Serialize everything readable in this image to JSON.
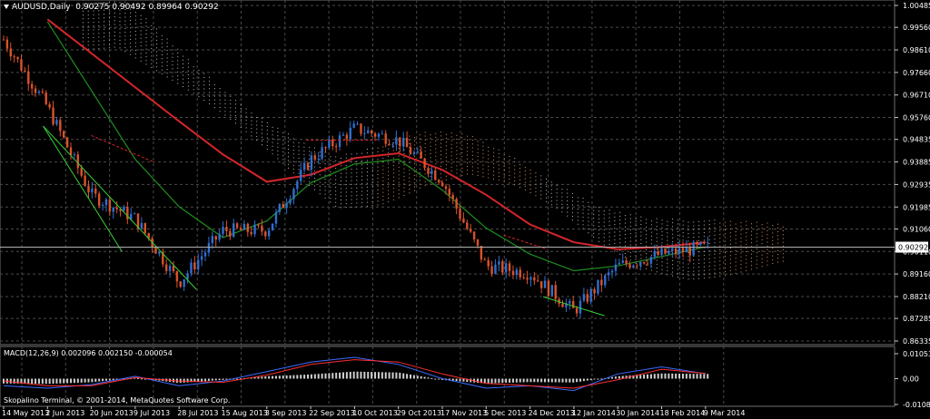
{
  "header": {
    "symbol": "AUDUSD,Daily",
    "ohlc": "0.90275 0.90492 0.89964 0.90292"
  },
  "macd_panel": {
    "label": "MACD(12,26,9) 0.002096 0.002150 -0.000054"
  },
  "footer": {
    "copyright": "Skopalino Terminal, © 2001-2014, MetaQuotes Software Corp."
  },
  "colors": {
    "background": "#000000",
    "grid": "#4a4a4a",
    "up_candle": "#2f6fd1",
    "down_candle": "#d9532b",
    "ma_slow": "#d4262a",
    "ma_fast": "#1f8f1f",
    "cloud_bear": "#c8b6b0",
    "cloud_bull": "#d99660",
    "current_price_line": "#b0b0b0",
    "trendline": "#37d137"
  },
  "chart_data": [
    {
      "type": "candlestick",
      "title": "AUDUSD,Daily",
      "x_ticks": [
        "14 May 2013",
        "2 Jun 2013",
        "20 Jun 2013",
        "9 Jul 2013",
        "28 Jul 2013",
        "15 Aug 2013",
        "3 Sep 2013",
        "22 Sep 2013",
        "10 Oct 2013",
        "29 Oct 2013",
        "17 Nov 2013",
        "5 Dec 2013",
        "24 Dec 2013",
        "12 Jan 2014",
        "30 Jan 2014",
        "18 Feb 2014",
        "9 Mar 2014"
      ],
      "y_ticks": [
        1.00485,
        0.9956,
        0.9861,
        0.9766,
        0.9671,
        0.9576,
        0.94835,
        0.93885,
        0.92935,
        0.91985,
        0.9106,
        0.9011,
        0.8916,
        0.8821,
        0.87285,
        0.86335
      ],
      "ylim": [
        0.86335,
        1.00485
      ],
      "current_price": 0.90292,
      "close_path": [
        {
          "x": "14 May 2013",
          "y": 0.9905
        },
        {
          "x": "2 Jun 2013",
          "y": 0.962
        },
        {
          "x": "20 Jun 2013",
          "y": 0.925
        },
        {
          "x": "9 Jul 2013",
          "y": 0.915
        },
        {
          "x": "28 Jul 2013",
          "y": 0.888
        },
        {
          "x": "15 Aug 2013",
          "y": 0.91
        },
        {
          "x": "3 Sep 2013",
          "y": 0.91
        },
        {
          "x": "22 Sep 2013",
          "y": 0.94
        },
        {
          "x": "10 Oct 2013",
          "y": 0.953
        },
        {
          "x": "29 Oct 2013",
          "y": 0.948
        },
        {
          "x": "17 Nov 2013",
          "y": 0.931
        },
        {
          "x": "5 Dec 2013",
          "y": 0.895
        },
        {
          "x": "24 Dec 2013",
          "y": 0.892
        },
        {
          "x": "12 Jan 2014",
          "y": 0.876
        },
        {
          "x": "30 Jan 2014",
          "y": 0.895
        },
        {
          "x": "18 Feb 2014",
          "y": 0.9
        },
        {
          "x": "9 Mar 2014",
          "y": 0.9029
        }
      ],
      "series": [
        {
          "type": "line",
          "color": "red",
          "values": [
            {
              "x": "2 Jun 2013",
              "y": 0.999
            },
            {
              "x": "28 Jul 2013",
              "y": 0.956
            },
            {
              "x": "15 Aug 2013",
              "y": 0.942
            },
            {
              "x": "3 Sep 2013",
              "y": 0.9305
            },
            {
              "x": "22 Sep 2013",
              "y": 0.9335
            },
            {
              "x": "10 Oct 2013",
              "y": 0.9405
            },
            {
              "x": "29 Oct 2013",
              "y": 0.9425
            },
            {
              "x": "17 Nov 2013",
              "y": 0.9355
            },
            {
              "x": "5 Dec 2013",
              "y": 0.925
            },
            {
              "x": "24 Dec 2013",
              "y": 0.9125
            },
            {
              "x": "12 Jan 2014",
              "y": 0.905
            },
            {
              "x": "30 Jan 2014",
              "y": 0.902
            },
            {
              "x": "18 Feb 2014",
              "y": 0.903
            },
            {
              "x": "9 Mar 2014",
              "y": 0.905
            }
          ]
        },
        {
          "type": "line",
          "color": "green",
          "values": [
            {
              "x": "2 Jun 2013",
              "y": 0.998
            },
            {
              "x": "9 Jul 2013",
              "y": 0.94
            },
            {
              "x": "28 Jul 2013",
              "y": 0.92
            },
            {
              "x": "15 Aug 2013",
              "y": 0.907
            },
            {
              "x": "3 Sep 2013",
              "y": 0.914
            },
            {
              "x": "22 Sep 2013",
              "y": 0.93
            },
            {
              "x": "10 Oct 2013",
              "y": 0.938
            },
            {
              "x": "29 Oct 2013",
              "y": 0.94
            },
            {
              "x": "17 Nov 2013",
              "y": 0.927
            },
            {
              "x": "5 Dec 2013",
              "y": 0.911
            },
            {
              "x": "24 Dec 2013",
              "y": 0.9
            },
            {
              "x": "12 Jan 2014",
              "y": 0.893
            },
            {
              "x": "30 Jan 2014",
              "y": 0.895
            },
            {
              "x": "18 Feb 2014",
              "y": 0.899
            },
            {
              "x": "9 Mar 2014",
              "y": 0.903
            }
          ]
        }
      ]
    },
    {
      "type": "bar",
      "title": "MACD(12,26,9) 0.002096 0.002150 -0.000054",
      "y_ticks": [
        0.01053,
        0.0,
        -0.01089
      ],
      "ylim": [
        -0.01089,
        0.01053
      ],
      "categories": [
        "14 May 2013",
        "2 Jun 2013",
        "20 Jun 2013",
        "9 Jul 2013",
        "28 Jul 2013",
        "15 Aug 2013",
        "3 Sep 2013",
        "22 Sep 2013",
        "10 Oct 2013",
        "29 Oct 2013",
        "17 Nov 2013",
        "5 Dec 2013",
        "24 Dec 2013",
        "12 Jan 2014",
        "30 Jan 2014",
        "18 Feb 2014",
        "9 Mar 2014"
      ],
      "series": [
        {
          "type": "bar",
          "values": [
            -0.002,
            -0.0022,
            -0.0015,
            0.0004,
            -0.0018,
            -0.0005,
            0.001,
            0.0018,
            0.003,
            0.0026,
            -0.0005,
            -0.002,
            -0.0014,
            -0.0016,
            0.001,
            0.0022,
            0.002
          ]
        },
        {
          "type": "line",
          "color": "blue",
          "values": [
            -0.003,
            -0.004,
            -0.0025,
            0.001,
            -0.003,
            -0.001,
            0.003,
            0.007,
            0.009,
            0.006,
            0.0,
            -0.004,
            -0.003,
            -0.005,
            0.002,
            0.005,
            0.0021
          ]
        },
        {
          "type": "line",
          "color": "red",
          "values": [
            -0.001,
            -0.003,
            -0.003,
            0.0005,
            -0.001,
            -0.0015,
            0.0015,
            0.006,
            0.008,
            0.007,
            0.002,
            -0.002,
            -0.003,
            -0.004,
            -0.0005,
            0.004,
            0.0022
          ]
        }
      ]
    }
  ]
}
